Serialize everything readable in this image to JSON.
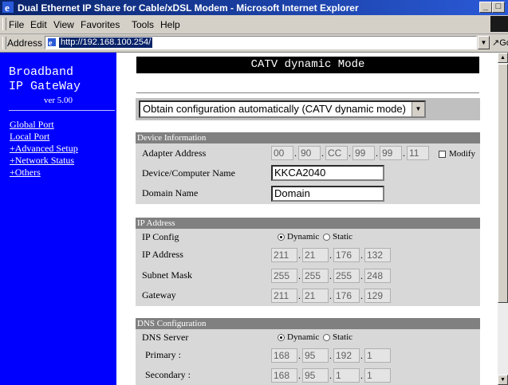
{
  "window": {
    "title": "Dual Ethernet IP Share for Cable/xDSL Modem - Microsoft Internet Explorer",
    "minimize": "_",
    "maximize": "□"
  },
  "menu": [
    "File",
    "Edit",
    "View",
    "Favorites",
    "Tools",
    "Help"
  ],
  "address": {
    "label": "Address",
    "url": "http://192.168.100.254/",
    "go": "↗Go"
  },
  "sidebar": {
    "brand_line1": "Broadband",
    "brand_line2": "IP GateWay",
    "version": "ver 5.00",
    "links": [
      "Global Port",
      "Local Port",
      "+Advanced Setup",
      "+Network Status",
      "+Others"
    ]
  },
  "page": {
    "title": "CATV dynamic Mode",
    "mode_select": "Obtain configuration automatically (CATV dynamic mode)"
  },
  "device_info": {
    "header": "Device Information",
    "adapter_label": "Adapter Address",
    "adapter": [
      "00",
      "90",
      "CC",
      "99",
      "99",
      "11"
    ],
    "modify_label": "Modify",
    "name_label": "Device/Computer Name",
    "name_value": "KKCA2040",
    "domain_label": "Domain Name",
    "domain_value": "Domain"
  },
  "ip_address": {
    "header": "IP Address",
    "config_label": "IP Config",
    "dynamic_label": "Dynamic",
    "static_label": "Static",
    "ip_label": "IP Address",
    "ip": [
      "211",
      "21",
      "176",
      "132"
    ],
    "mask_label": "Subnet Mask",
    "mask": [
      "255",
      "255",
      "255",
      "248"
    ],
    "gateway_label": "Gateway",
    "gateway": [
      "211",
      "21",
      "176",
      "129"
    ]
  },
  "dns": {
    "header": "DNS Configuration",
    "server_label": "DNS Server",
    "dynamic_label": "Dynamic",
    "static_label": "Static",
    "primary_label": "Primary :",
    "primary": [
      "168",
      "95",
      "192",
      "1"
    ],
    "secondary_label": "Secondary :",
    "secondary": [
      "168",
      "95",
      "1",
      "1"
    ]
  },
  "colors": {
    "sidebar_bg": "#0000ff",
    "titlebar_start": "#0a246a",
    "section_header": "#808080",
    "row_bg": "#d8d8d8"
  },
  "icons": {
    "browser": "ie-icon",
    "page": "page-icon",
    "dropdown": "chevron-down-icon"
  }
}
